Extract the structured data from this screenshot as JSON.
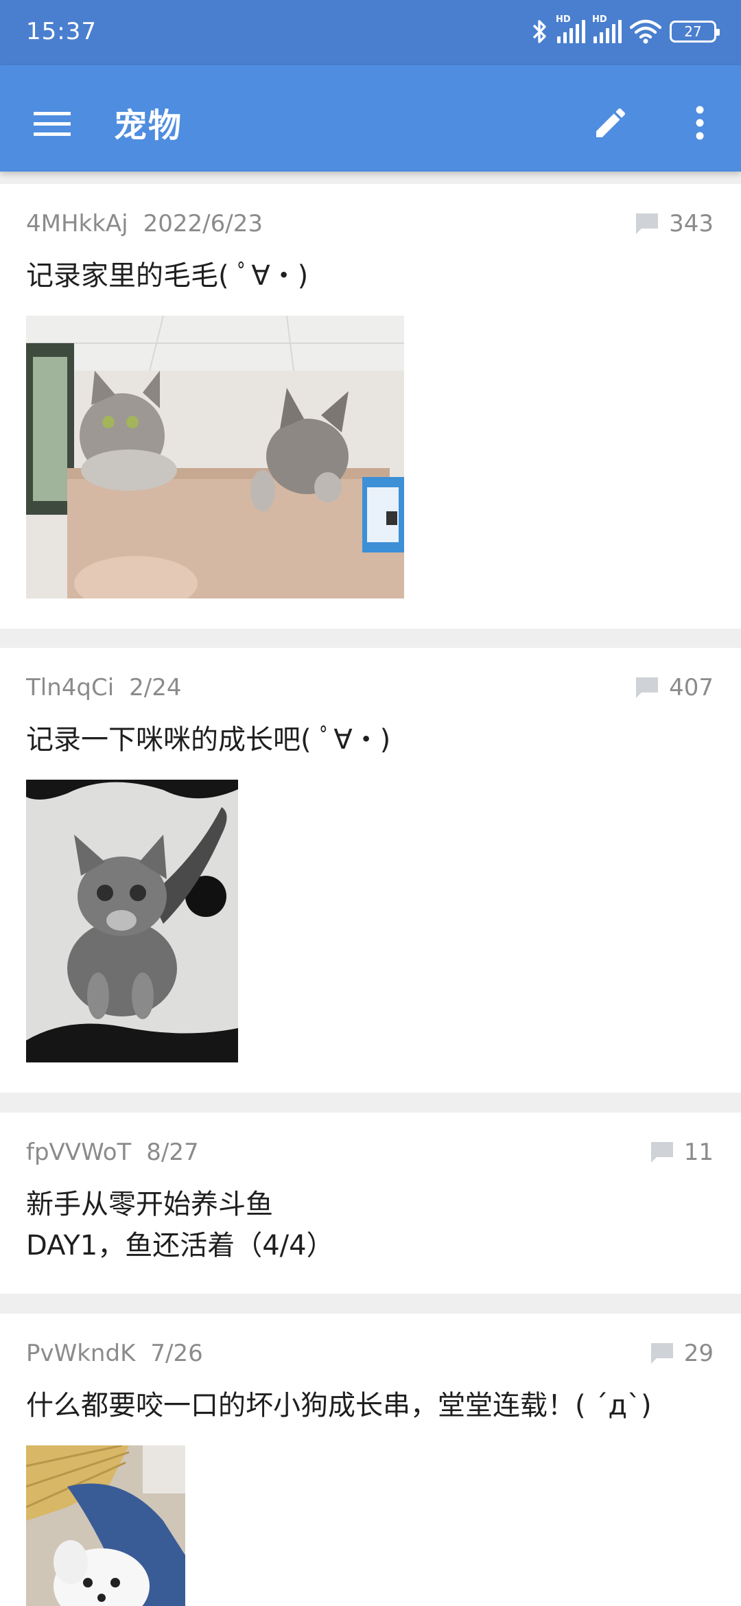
{
  "status_bar": {
    "time": "15:37",
    "battery": "27",
    "hd": "HD"
  },
  "app_bar": {
    "title": "宠物"
  },
  "posts": [
    {
      "author": "4MHkkAj",
      "date": "2022/6/23",
      "comments": "343",
      "title": "记录家里的毛毛( ﾟ∀・)",
      "image": "two-cats-on-box"
    },
    {
      "author": "Tln4qCi",
      "date": "2/24",
      "comments": "407",
      "title": "记录一下咪咪的成长吧( ﾟ∀・)",
      "image": "kitten-on-rug"
    },
    {
      "author": "fpVVWoT",
      "date": "8/27",
      "comments": "11",
      "title_line1": "新手从零开始养斗鱼",
      "title_line2": "DAY1，鱼还活着（4/4）"
    },
    {
      "author": "PvWkndK",
      "date": "7/26",
      "comments": "29",
      "title": "什么都要咬一口的坏小狗成长串，堂堂连载！( ´д`)",
      "image": "puppy-with-fan"
    }
  ],
  "colors": {
    "status_bar": "#4a7fcf",
    "app_bar": "#4e8ddf",
    "meta_text": "#8b8b8b"
  }
}
